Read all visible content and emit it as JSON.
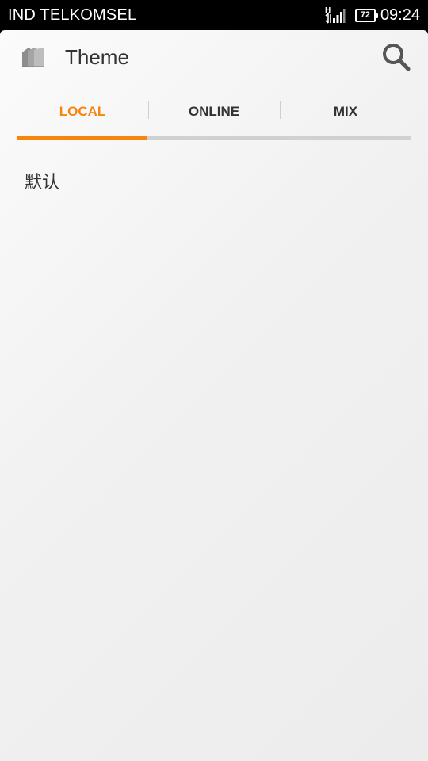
{
  "status_bar": {
    "carrier": "IND TELKOMSEL",
    "network_type": "H",
    "battery_level": "72",
    "time": "09:24",
    "icons": [
      "signal-icon",
      "battery-icon"
    ]
  },
  "action_bar": {
    "title": "Theme",
    "icons": [
      "theme-app-icon",
      "search-icon"
    ]
  },
  "tabs": [
    {
      "label": "LOCAL",
      "active": true
    },
    {
      "label": "ONLINE",
      "active": false
    },
    {
      "label": "MIX",
      "active": false
    }
  ],
  "theme_list": {
    "items": [
      "默认"
    ]
  },
  "colors": {
    "accent": "#f7840b",
    "text": "#333333",
    "background": "#efefef",
    "tab_track": "#d0d0d0"
  }
}
